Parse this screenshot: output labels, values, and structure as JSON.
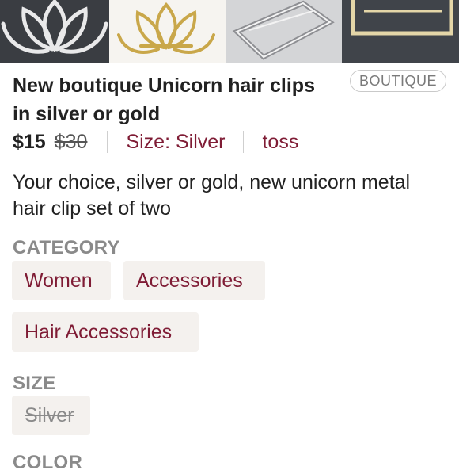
{
  "listing": {
    "title": "New boutique Unicorn hair clips in silver or gold",
    "badge": "BOUTIQUE",
    "price": "$15",
    "original_price": "$30",
    "size_label": "Size: Silver",
    "seller": "toss",
    "description": "Your choice, silver or gold, new unicorn metal hair clip set of two"
  },
  "photos": [
    {
      "icon": "lotus-clip-silver"
    },
    {
      "icon": "lotus-clip-gold"
    },
    {
      "icon": "rectangle-clip-silver"
    },
    {
      "icon": "rectangle-clip-gold"
    }
  ],
  "category": {
    "label": "CATEGORY",
    "chips": [
      "Women",
      "Accessories",
      "Hair Accessories"
    ]
  },
  "size": {
    "label": "SIZE",
    "options": [
      "Silver"
    ]
  },
  "color": {
    "label": "COLOR"
  },
  "colors": {
    "accent": "#7f1c35",
    "chip_bg": "#f4f1ee",
    "label_gray": "#8a8a8a"
  }
}
